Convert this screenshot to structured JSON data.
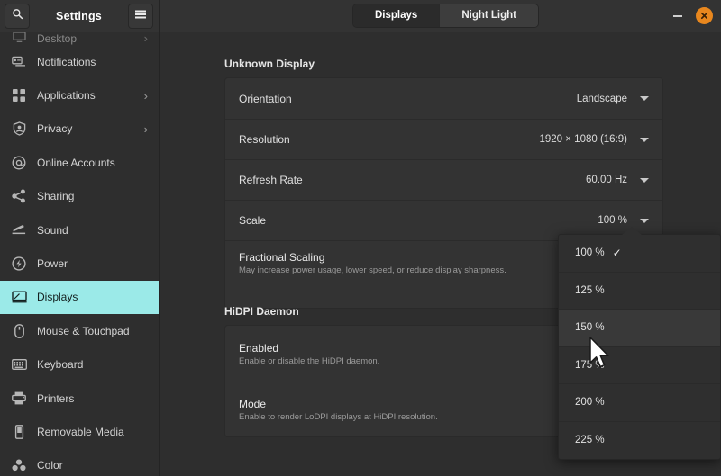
{
  "window": {
    "title": "Settings",
    "search_icon": "search-icon",
    "menu_icon": "hamburger-menu-icon",
    "minimize_label": "Minimize",
    "close_label": "Close"
  },
  "tabs": [
    {
      "label": "Displays",
      "active": true
    },
    {
      "label": "Night Light",
      "active": false
    }
  ],
  "sidebar": {
    "items": [
      {
        "label": "Desktop",
        "icon": "desktop-icon",
        "chevron": true,
        "clipped": true,
        "selected": false
      },
      {
        "label": "Notifications",
        "icon": "notifications-icon",
        "chevron": false,
        "selected": false
      },
      {
        "label": "Applications",
        "icon": "applications-grid-icon",
        "chevron": true,
        "selected": false
      },
      {
        "label": "Privacy",
        "icon": "privacy-shield-icon",
        "chevron": true,
        "selected": false
      },
      {
        "label": "Online Accounts",
        "icon": "at-sign-icon",
        "chevron": false,
        "selected": false
      },
      {
        "label": "Sharing",
        "icon": "share-nodes-icon",
        "chevron": false,
        "selected": false
      },
      {
        "label": "Sound",
        "icon": "sound-wave-icon",
        "chevron": false,
        "selected": false
      },
      {
        "label": "Power",
        "icon": "power-icon",
        "chevron": false,
        "selected": false
      },
      {
        "label": "Displays",
        "icon": "display-monitor-icon",
        "chevron": false,
        "selected": true
      },
      {
        "label": "Mouse & Touchpad",
        "icon": "mouse-icon",
        "chevron": false,
        "selected": false
      },
      {
        "label": "Keyboard",
        "icon": "keyboard-icon",
        "chevron": false,
        "selected": false
      },
      {
        "label": "Printers",
        "icon": "printer-icon",
        "chevron": false,
        "selected": false
      },
      {
        "label": "Removable Media",
        "icon": "removable-media-icon",
        "chevron": false,
        "selected": false
      },
      {
        "label": "Color",
        "icon": "color-dots-icon",
        "chevron": false,
        "selected": false
      }
    ]
  },
  "main": {
    "display_section_title": "Unknown Display",
    "display_rows": [
      {
        "label": "Orientation",
        "value": "Landscape"
      },
      {
        "label": "Resolution",
        "value": "1920 × 1080 (16:9)"
      },
      {
        "label": "Refresh Rate",
        "value": "60.00 Hz"
      },
      {
        "label": "Scale",
        "value": "100 %"
      }
    ],
    "fractional_scaling": {
      "title": "Fractional Scaling",
      "subtitle": "May increase power usage, lower speed, or reduce display sharpness."
    },
    "hidpi_section_title": "HiDPI Daemon",
    "hidpi_rows": [
      {
        "title": "Enabled",
        "subtitle": "Enable or disable the HiDPI daemon."
      },
      {
        "title": "Mode",
        "subtitle": "Enable to render LoDPI displays at HiDPI resolution."
      }
    ]
  },
  "scale_dropdown": {
    "open": true,
    "items": [
      {
        "label": "100 %",
        "checked": true,
        "hovered": false
      },
      {
        "label": "125 %",
        "checked": false,
        "hovered": false
      },
      {
        "label": "150 %",
        "checked": false,
        "hovered": true
      },
      {
        "label": "175 %",
        "checked": false,
        "hovered": false
      },
      {
        "label": "200 %",
        "checked": false,
        "hovered": false
      },
      {
        "label": "225 %",
        "checked": false,
        "hovered": false
      }
    ],
    "check_glyph": "✓"
  },
  "colors": {
    "window_bg": "#2e2e2e",
    "header_bg": "#333333",
    "card_bg": "#333333",
    "selected_sidebar": "#9beae8",
    "close_button": "#e8871e",
    "popup_bg": "#2f2f2f",
    "popup_hover": "#393939"
  }
}
